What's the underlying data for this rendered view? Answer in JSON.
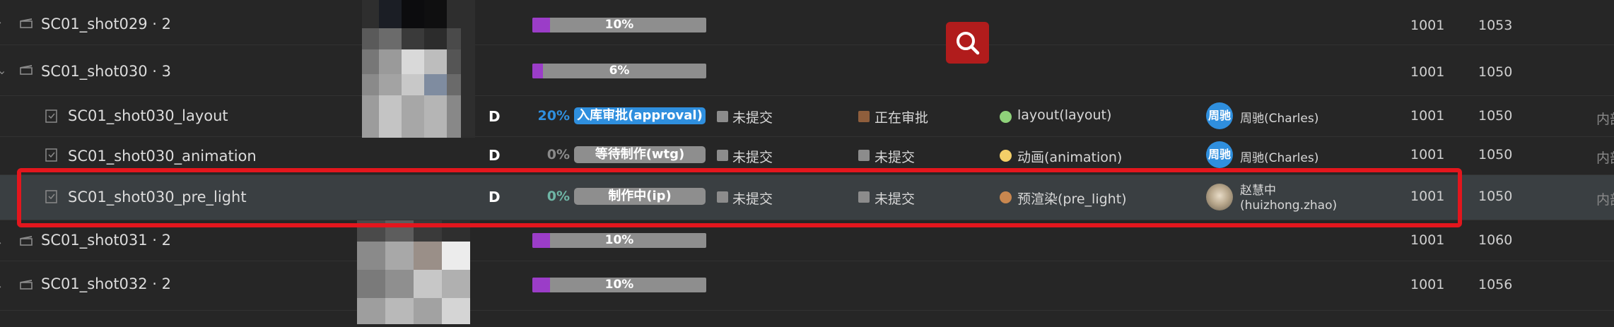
{
  "rows": [
    {
      "name": "SC01_shot029 · 2",
      "progress_label": "10%",
      "progress": 0.1,
      "start": "1001",
      "end": "1053"
    },
    {
      "name": "SC01_shot030 · 3",
      "progress_label": "6%",
      "progress": 0.06,
      "start": "1001",
      "end": "1050"
    },
    {
      "name": "SC01_shot030_layout",
      "d": "D",
      "pct": "20%",
      "status": "入库审批(approval)",
      "check1": "未提交",
      "check2": "正在审批",
      "step": "layout(layout)",
      "avatar": "周驰",
      "assignee": "周驰(Charles)",
      "start": "1001",
      "end": "1050",
      "extra": "内部"
    },
    {
      "name": "SC01_shot030_animation",
      "d": "D",
      "pct": "0%",
      "status": "等待制作(wtg)",
      "check1": "未提交",
      "check2": "未提交",
      "step": "动画(animation)",
      "avatar": "周驰",
      "assignee": "周驰(Charles)",
      "start": "1001",
      "end": "1050",
      "extra": "内部"
    },
    {
      "name": "SC01_shot030_pre_light",
      "d": "D",
      "pct": "0%",
      "status": "制作中(ip)",
      "check1": "未提交",
      "check2": "未提交",
      "step": "预渲染(pre_light)",
      "assignee_line1": "赵慧中",
      "assignee_line2": "(huizhong.zhao)",
      "start": "1001",
      "end": "1050",
      "extra": "内部"
    },
    {
      "name": "SC01_shot031 · 2",
      "progress_label": "10%",
      "progress": 0.1,
      "start": "1001",
      "end": "1060"
    },
    {
      "name": "SC01_shot032 · 2",
      "progress_label": "10%",
      "progress": 0.1,
      "start": "1001",
      "end": "1056"
    }
  ],
  "colors": {
    "accent": "#2f8fde",
    "progress_fill": "#9b3dc8",
    "highlight": "#e3161d",
    "search_button": "#b11c1c"
  }
}
